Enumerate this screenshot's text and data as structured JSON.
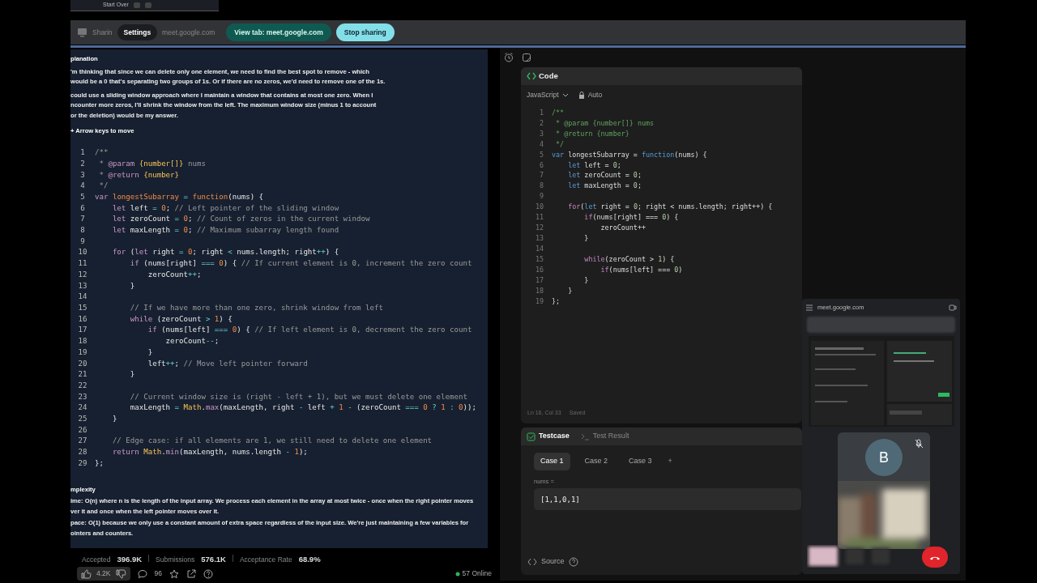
{
  "top_panel": {
    "label": "Start Over"
  },
  "share_bar": {
    "label_start": "Sharin",
    "tooltip": "Settings",
    "label_end": "meet.google.com",
    "view_button": "View tab: meet.google.com",
    "stop_button": "Stop sharing"
  },
  "assistant": {
    "heading": "planation",
    "paragraphs": [
      [
        "'m thinking that since we can delete only one element, we need to find the best spot to remove - which",
        "would be a 0 that's separating two groups of 1s. Or if there are no zeros, we'd need to remove one of the 1s."
      ],
      [
        "could use a sliding window approach where I maintain a window that contains at most one zero. When I",
        "ncounter more zeros, I'll shrink the window from the left. The maximum window size (minus 1 to account",
        "or the deletion) would be my answer."
      ]
    ],
    "hint": "+ Arrow keys to move",
    "code": [
      {
        "n": "1",
        "segs": [
          {
            "text": "/**",
            "kind": "comment"
          }
        ]
      },
      {
        "n": "2",
        "segs": [
          {
            "text": " * ",
            "kind": "comment"
          },
          {
            "text": "@param",
            "kind": "keyword"
          },
          {
            "text": " {number[]}",
            "kind": "type"
          },
          {
            "text": " nums",
            "kind": "comment"
          }
        ]
      },
      {
        "n": "3",
        "segs": [
          {
            "text": " * ",
            "kind": "comment"
          },
          {
            "text": "@return",
            "kind": "keyword"
          },
          {
            "text": " {number}",
            "kind": "type"
          }
        ]
      },
      {
        "n": "4",
        "segs": [
          {
            "text": " */",
            "kind": "comment"
          }
        ]
      },
      {
        "n": "5",
        "segs": [
          {
            "text": "var",
            "kind": "keyword"
          },
          {
            "text": " longestSubarray",
            "kind": "name"
          },
          {
            "text": " = ",
            "kind": "op"
          },
          {
            "text": "function",
            "kind": "name"
          },
          {
            "text": "(nums) {",
            "kind": "plain"
          }
        ]
      },
      {
        "n": "6",
        "segs": [
          {
            "text": "    let",
            "kind": "keyword"
          },
          {
            "text": " left ",
            "kind": "plain"
          },
          {
            "text": "=",
            "kind": "op"
          },
          {
            "text": " 0",
            "kind": "number"
          },
          {
            "text": "; ",
            "kind": "plain"
          },
          {
            "text": "// Left pointer of the sliding window",
            "kind": "comment"
          }
        ]
      },
      {
        "n": "7",
        "segs": [
          {
            "text": "    let",
            "kind": "keyword"
          },
          {
            "text": " zeroCount ",
            "kind": "plain"
          },
          {
            "text": "=",
            "kind": "op"
          },
          {
            "text": " 0",
            "kind": "number"
          },
          {
            "text": "; ",
            "kind": "plain"
          },
          {
            "text": "// Count of zeros in the current window",
            "kind": "comment"
          }
        ]
      },
      {
        "n": "8",
        "segs": [
          {
            "text": "    let",
            "kind": "keyword"
          },
          {
            "text": " maxLength ",
            "kind": "plain"
          },
          {
            "text": "=",
            "kind": "op"
          },
          {
            "text": " 0",
            "kind": "number"
          },
          {
            "text": "; ",
            "kind": "plain"
          },
          {
            "text": "// Maximum subarray length found",
            "kind": "comment"
          }
        ]
      },
      {
        "n": "9"
      },
      {
        "n": "10",
        "segs": [
          {
            "text": "    for",
            "kind": "keyword"
          },
          {
            "text": " (",
            "kind": "plain"
          },
          {
            "text": "let",
            "kind": "keyword"
          },
          {
            "text": " right ",
            "kind": "plain"
          },
          {
            "text": "=",
            "kind": "op"
          },
          {
            "text": " 0",
            "kind": "number"
          },
          {
            "text": "; right ",
            "kind": "plain"
          },
          {
            "text": "<",
            "kind": "op"
          },
          {
            "text": " nums.length; right",
            "kind": "plain"
          },
          {
            "text": "++",
            "kind": "op"
          },
          {
            "text": ") {",
            "kind": "plain"
          }
        ]
      },
      {
        "n": "11",
        "segs": [
          {
            "text": "        if",
            "kind": "keyword"
          },
          {
            "text": " (nums[right] ",
            "kind": "plain"
          },
          {
            "text": "===",
            "kind": "op"
          },
          {
            "text": " 0",
            "kind": "number"
          },
          {
            "text": ") { ",
            "kind": "plain"
          },
          {
            "text": "// If current element is 0, increment the zero count",
            "kind": "comment"
          }
        ]
      },
      {
        "n": "12",
        "segs": [
          {
            "text": "            zeroCount",
            "kind": "plain"
          },
          {
            "text": "++",
            "kind": "op"
          },
          {
            "text": ";",
            "kind": "plain"
          }
        ]
      },
      {
        "n": "13",
        "segs": [
          {
            "text": "        }",
            "kind": "plain"
          }
        ]
      },
      {
        "n": "14"
      },
      {
        "n": "15",
        "segs": [
          {
            "text": "        // If we have more than one zero, shrink window from left",
            "kind": "comment"
          }
        ]
      },
      {
        "n": "16",
        "segs": [
          {
            "text": "        while",
            "kind": "keyword"
          },
          {
            "text": " (zeroCount ",
            "kind": "plain"
          },
          {
            "text": ">",
            "kind": "op"
          },
          {
            "text": " 1",
            "kind": "number"
          },
          {
            "text": ") {",
            "kind": "plain"
          }
        ]
      },
      {
        "n": "17",
        "segs": [
          {
            "text": "            if",
            "kind": "keyword"
          },
          {
            "text": " (nums[left] ",
            "kind": "plain"
          },
          {
            "text": "===",
            "kind": "op"
          },
          {
            "text": " 0",
            "kind": "number"
          },
          {
            "text": ") { ",
            "kind": "plain"
          },
          {
            "text": "// If left element is 0, decrement the zero count",
            "kind": "comment"
          }
        ]
      },
      {
        "n": "18",
        "segs": [
          {
            "text": "                zeroCount",
            "kind": "plain"
          },
          {
            "text": "--",
            "kind": "op"
          },
          {
            "text": ";",
            "kind": "plain"
          }
        ]
      },
      {
        "n": "19",
        "segs": [
          {
            "text": "            }",
            "kind": "plain"
          }
        ]
      },
      {
        "n": "20",
        "segs": [
          {
            "text": "            left",
            "kind": "plain"
          },
          {
            "text": "++",
            "kind": "op"
          },
          {
            "text": "; ",
            "kind": "plain"
          },
          {
            "text": "// Move left pointer forward",
            "kind": "comment"
          }
        ]
      },
      {
        "n": "21",
        "segs": [
          {
            "text": "        }",
            "kind": "plain"
          }
        ]
      },
      {
        "n": "22"
      },
      {
        "n": "23",
        "segs": [
          {
            "text": "        // Current window size is (right - left + 1), but we must delete one element",
            "kind": "comment"
          }
        ]
      },
      {
        "n": "24",
        "segs": [
          {
            "text": "        maxLength ",
            "kind": "plain"
          },
          {
            "text": "=",
            "kind": "op"
          },
          {
            "text": " Math",
            "kind": "type"
          },
          {
            "text": ".",
            "kind": "plain"
          },
          {
            "text": "max",
            "kind": "keyword"
          },
          {
            "text": "(maxLength, right ",
            "kind": "plain"
          },
          {
            "text": "-",
            "kind": "op"
          },
          {
            "text": " left ",
            "kind": "plain"
          },
          {
            "text": "+",
            "kind": "op"
          },
          {
            "text": " 1",
            "kind": "number"
          },
          {
            "text": " -",
            "kind": "op"
          },
          {
            "text": " (zeroCount ",
            "kind": "plain"
          },
          {
            "text": "===",
            "kind": "op"
          },
          {
            "text": " 0",
            "kind": "number"
          },
          {
            "text": " ? ",
            "kind": "op"
          },
          {
            "text": "1",
            "kind": "number"
          },
          {
            "text": " : ",
            "kind": "op"
          },
          {
            "text": "0",
            "kind": "number"
          },
          {
            "text": "));",
            "kind": "plain"
          }
        ]
      },
      {
        "n": "25",
        "segs": [
          {
            "text": "    }",
            "kind": "plain"
          }
        ]
      },
      {
        "n": "26"
      },
      {
        "n": "27",
        "segs": [
          {
            "text": "    // Edge case: if all elements are 1, we still need to delete one element",
            "kind": "comment"
          }
        ]
      },
      {
        "n": "28",
        "segs": [
          {
            "text": "    return",
            "kind": "keyword"
          },
          {
            "text": " Math",
            "kind": "type"
          },
          {
            "text": ".",
            "kind": "plain"
          },
          {
            "text": "min",
            "kind": "keyword"
          },
          {
            "text": "(maxLength, nums.length ",
            "kind": "plain"
          },
          {
            "text": "-",
            "kind": "op"
          },
          {
            "text": " 1",
            "kind": "number"
          },
          {
            "text": ");",
            "kind": "plain"
          }
        ]
      },
      {
        "n": "29",
        "segs": [
          {
            "text": "};",
            "kind": "plain"
          }
        ]
      }
    ],
    "complexity_heading": "mplexity",
    "complexity": [
      [
        "**ime:** O(n) where n is the length of the input array. We process each element in the array at most twice - once when the right pointer moves",
        "ver it and once when the left pointer moves over it."
      ],
      [
        "**pace:** O(1) because we only use a constant amount of extra space regardless of the input size. We're just maintaining a few variables for",
        "ointers and counters."
      ]
    ]
  },
  "stats": [
    {
      "label": "Accepted",
      "value": "396.9K"
    },
    {
      "label": "Submissions",
      "value": "576.1K"
    },
    {
      "label": "Acceptance Rate",
      "value": "68.9%"
    }
  ],
  "actions": {
    "likes": "4.2K",
    "comments": "96",
    "online": "57 Online"
  },
  "editor": {
    "title": "Code",
    "language": "JavaScript",
    "mode": "Auto",
    "status": "Ln 16, Col 33",
    "saved": "Saved",
    "lines": [
      {
        "n": "1",
        "segs": [
          {
            "text": "/**",
            "kind": "comment"
          }
        ]
      },
      {
        "n": "2",
        "segs": [
          {
            "text": " * @param {number[]} nums",
            "kind": "comment"
          }
        ]
      },
      {
        "n": "3",
        "segs": [
          {
            "text": " * @return {number}",
            "kind": "comment"
          }
        ]
      },
      {
        "n": "4",
        "segs": [
          {
            "text": " */",
            "kind": "comment"
          }
        ]
      },
      {
        "n": "5",
        "segs": [
          {
            "text": "var",
            "kind": "storage"
          },
          {
            "text": " longestSubarray = ",
            "kind": "plain"
          },
          {
            "text": "function",
            "kind": "storage"
          },
          {
            "text": "(nums) {",
            "kind": "plain"
          }
        ]
      },
      {
        "n": "6",
        "segs": [
          {
            "text": "    let",
            "kind": "storage"
          },
          {
            "text": " left = ",
            "kind": "plain"
          },
          {
            "text": "0",
            "kind": "number"
          },
          {
            "text": ";",
            "kind": "plain"
          }
        ]
      },
      {
        "n": "7",
        "segs": [
          {
            "text": "    let",
            "kind": "storage"
          },
          {
            "text": " zeroCount = ",
            "kind": "plain"
          },
          {
            "text": "0",
            "kind": "number"
          },
          {
            "text": ";",
            "kind": "plain"
          }
        ]
      },
      {
        "n": "8",
        "segs": [
          {
            "text": "    let",
            "kind": "storage"
          },
          {
            "text": " maxLength = ",
            "kind": "plain"
          },
          {
            "text": "0",
            "kind": "number"
          },
          {
            "text": ";",
            "kind": "plain"
          }
        ]
      },
      {
        "n": "9"
      },
      {
        "n": "10",
        "segs": [
          {
            "text": "    for",
            "kind": "keyword"
          },
          {
            "text": "(",
            "kind": "plain"
          },
          {
            "text": "let",
            "kind": "storage"
          },
          {
            "text": " right = ",
            "kind": "plain"
          },
          {
            "text": "0",
            "kind": "number"
          },
          {
            "text": "; right < nums.length; right++) {",
            "kind": "plain"
          }
        ]
      },
      {
        "n": "11",
        "segs": [
          {
            "text": "        if",
            "kind": "keyword"
          },
          {
            "text": "(nums[right] === ",
            "kind": "plain"
          },
          {
            "text": "0",
            "kind": "number"
          },
          {
            "text": ") {",
            "kind": "plain"
          }
        ]
      },
      {
        "n": "12",
        "segs": [
          {
            "text": "            zeroCount++",
            "kind": "plain"
          }
        ]
      },
      {
        "n": "13",
        "segs": [
          {
            "text": "        }",
            "kind": "plain"
          }
        ]
      },
      {
        "n": "14"
      },
      {
        "n": "15",
        "segs": [
          {
            "text": "        while",
            "kind": "keyword"
          },
          {
            "text": "(zeroCount > ",
            "kind": "plain"
          },
          {
            "text": "1",
            "kind": "number"
          },
          {
            "text": ") {",
            "kind": "plain"
          }
        ]
      },
      {
        "n": "16",
        "segs": [
          {
            "text": "            if",
            "kind": "keyword"
          },
          {
            "text": "(nums[left] === ",
            "kind": "plain"
          },
          {
            "text": "0",
            "kind": "number"
          },
          {
            "text": ")",
            "kind": "plain"
          }
        ]
      },
      {
        "n": "17",
        "segs": [
          {
            "text": "        }",
            "kind": "plain"
          }
        ]
      },
      {
        "n": "18",
        "segs": [
          {
            "text": "    }",
            "kind": "plain"
          }
        ]
      },
      {
        "n": "19",
        "segs": [
          {
            "text": "};",
            "kind": "plain"
          }
        ]
      }
    ]
  },
  "testcase": {
    "tabs": [
      {
        "label": "Testcase",
        "selected": true
      },
      {
        "label": "Test Result",
        "selected": false
      }
    ],
    "cases": [
      {
        "label": "Case 1",
        "selected": true
      },
      {
        "label": "Case 2",
        "selected": false
      },
      {
        "label": "Case 3",
        "selected": false
      }
    ],
    "add": "+",
    "param": "nums =",
    "value": "[1,1,0,1]",
    "source": "Source"
  },
  "meet": {
    "url": "meet.google.com",
    "participant": {
      "initial": "B",
      "muted": true
    }
  }
}
